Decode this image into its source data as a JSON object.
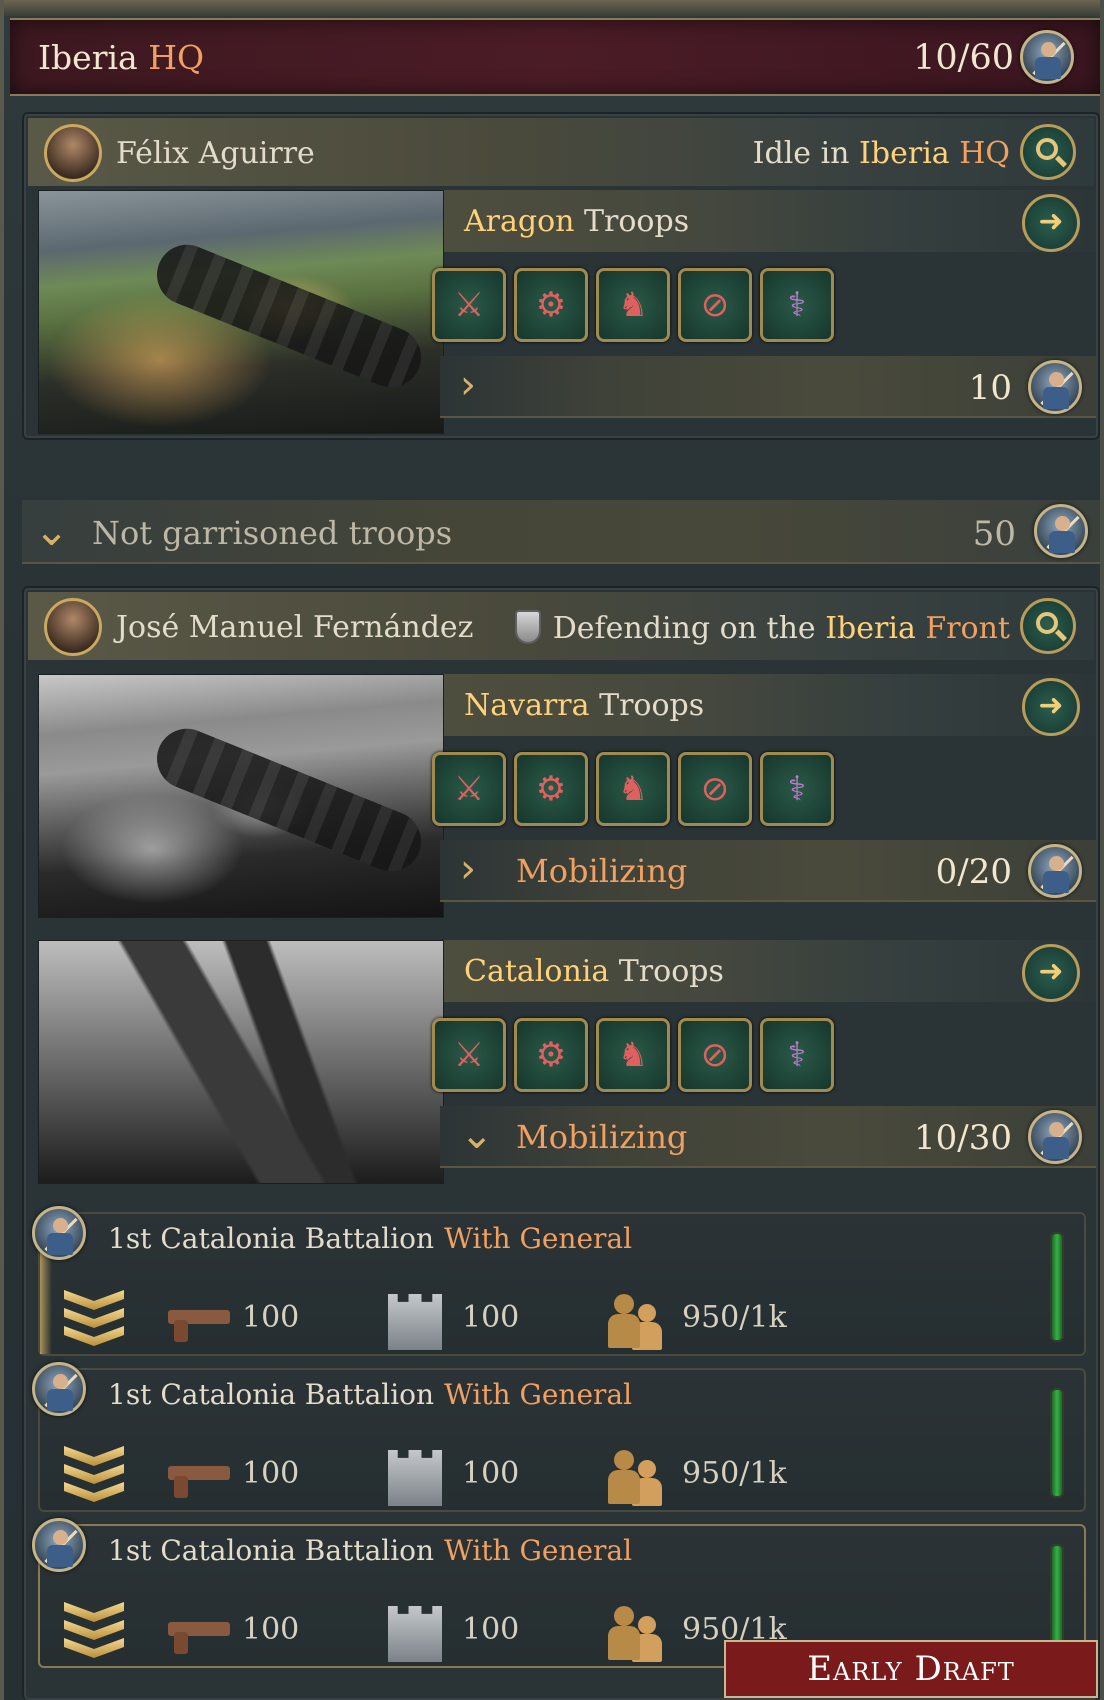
{
  "header": {
    "title_main": "Iberia",
    "title_accent": "HQ",
    "count": "10/60",
    "icon": "soldier-icon"
  },
  "group1": {
    "leader_name": "Félix Aguirre",
    "status_prefix": "Idle in",
    "status_place": "Iberia",
    "status_accent": "HQ",
    "troop": {
      "title_gold": "Aragon",
      "title_rest": " Troops",
      "count": "10"
    }
  },
  "not_garrisoned": {
    "label": "Not garrisoned troops",
    "count": "50"
  },
  "group2": {
    "leader_name": "José Manuel Fernández",
    "status_prefix": "Defending on the",
    "status_place": "Iberia",
    "status_accent": "Front",
    "troops": [
      {
        "title_gold": "Navarra",
        "title_rest": " Troops",
        "status": "Mobilizing",
        "count": "0/20"
      },
      {
        "title_gold": "Catalonia",
        "title_rest": " Troops",
        "status": "Mobilizing",
        "count": "10/30"
      }
    ]
  },
  "unit_icons": [
    "infantry-icon",
    "artillery-icon",
    "cavalry-icon",
    "no-officer-icon",
    "medic-icon"
  ],
  "battalions": [
    {
      "name": "1st Catalonia Battalion",
      "tag": "With General",
      "rifle": "100",
      "fort": "100",
      "manpower": "950/1k"
    },
    {
      "name": "1st Catalonia Battalion",
      "tag": "With General",
      "rifle": "100",
      "fort": "100",
      "manpower": "950/1k"
    },
    {
      "name": "1st Catalonia Battalion",
      "tag": "With General",
      "rifle": "100",
      "fort": "100",
      "manpower": "950/1k"
    }
  ],
  "watermark": "Early Draft",
  "colors": {
    "accent_orange": "#f0a060",
    "accent_gold": "#ffd27a",
    "header_bg": "#4b1c26",
    "panel_bg": "#2a3437"
  }
}
